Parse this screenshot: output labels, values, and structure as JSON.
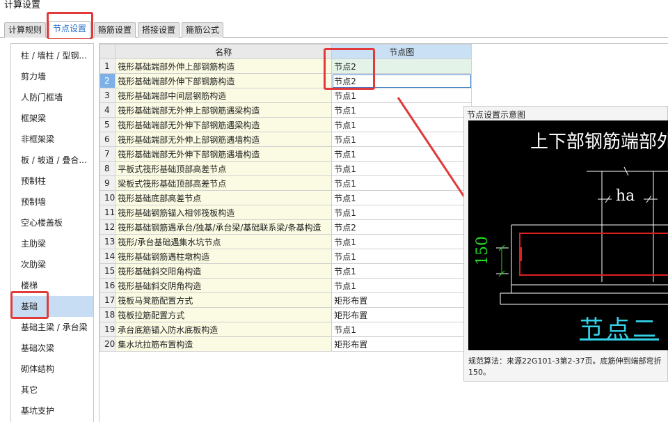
{
  "window": {
    "title": "计算设置"
  },
  "tabs": [
    {
      "label": "计算规则",
      "active": false
    },
    {
      "label": "节点设置",
      "active": true
    },
    {
      "label": "箍筋设置",
      "active": false
    },
    {
      "label": "搭接设置",
      "active": false
    },
    {
      "label": "箍筋公式",
      "active": false
    }
  ],
  "sidebar": {
    "items": [
      "柱 / 墙柱 / 型钢...",
      "剪力墙",
      "人防门框墙",
      "框架梁",
      "非框架梁",
      "板 / 坡道 / 叠合...",
      "预制柱",
      "预制墙",
      "空心楼盖板",
      "主肋梁",
      "次肋梁",
      "楼梯",
      "基础",
      "基础主梁 / 承台梁",
      "基础次梁",
      "砌体结构",
      "其它",
      "基坑支护"
    ],
    "selected_index": 12
  },
  "grid": {
    "headers": {
      "name": "名称",
      "node": "节点图"
    },
    "rows": [
      {
        "no": "1",
        "name": "筏形基础端部外伸上部钢筋构造",
        "node": "节点2"
      },
      {
        "no": "2",
        "name": "筏形基础端部外伸下部钢筋构造",
        "node": "节点2"
      },
      {
        "no": "3",
        "name": "筏形基础端部中间层钢筋构造",
        "node": "节点1"
      },
      {
        "no": "4",
        "name": "筏形基础端部无外伸上部钢筋遇梁构造",
        "node": "节点1"
      },
      {
        "no": "5",
        "name": "筏形基础端部无外伸下部钢筋遇梁构造",
        "node": "节点1"
      },
      {
        "no": "6",
        "name": "筏形基础端部无外伸上部钢筋遇墙构造",
        "node": "节点1"
      },
      {
        "no": "7",
        "name": "筏形基础端部无外伸下部钢筋遇墙构造",
        "node": "节点1"
      },
      {
        "no": "8",
        "name": "平板式筏形基础顶部高差节点",
        "node": "节点1"
      },
      {
        "no": "9",
        "name": "梁板式筏形基础顶部高差节点",
        "node": "节点1"
      },
      {
        "no": "10",
        "name": "筏形基础底部高差节点",
        "node": "节点1"
      },
      {
        "no": "11",
        "name": "筏形基础钢筋锚入相邻筏板构造",
        "node": "节点1"
      },
      {
        "no": "12",
        "name": "筏形基础钢筋遇承台/独基/承台梁/基础联系梁/条基构造",
        "node": "节点2"
      },
      {
        "no": "13",
        "name": "筏形/承台基础遇集水坑节点",
        "node": "节点1"
      },
      {
        "no": "14",
        "name": "筏形基础钢筋遇柱墩构造",
        "node": "节点1"
      },
      {
        "no": "15",
        "name": "筏形基础斜交阳角构造",
        "node": "节点1"
      },
      {
        "no": "16",
        "name": "筏形基础斜交阴角构造",
        "node": "节点1"
      },
      {
        "no": "17",
        "name": "筏板马凳筋配置方式",
        "node": "矩形布置"
      },
      {
        "no": "18",
        "name": "筏板拉筋配置方式",
        "node": "矩形布置"
      },
      {
        "no": "19",
        "name": "承台底筋锚入防水底板构造",
        "node": "节点1"
      },
      {
        "no": "20",
        "name": "集水坑拉筋布置构造",
        "node": "矩形布置"
      }
    ],
    "selected_row": 1,
    "highlighted_row": 0
  },
  "preview": {
    "title": "节点设置示意图",
    "diagram_title": "上下部钢筋端部外",
    "label_ha": "ha",
    "label_150": "150",
    "node_name": "节点二",
    "description": "规范算法：来源22G101-3第2-37页。底筋伸到端部弯折150。"
  },
  "colors": {
    "annotation_red": "#e03a3a",
    "selection_blue": "#c7ddf3",
    "node_header": "#c9e0f5",
    "name_cell": "#fbfbe3",
    "diagram_cyan": "#34d2e8",
    "diagram_green": "#22dd22",
    "rebar_red": "#e02020"
  }
}
